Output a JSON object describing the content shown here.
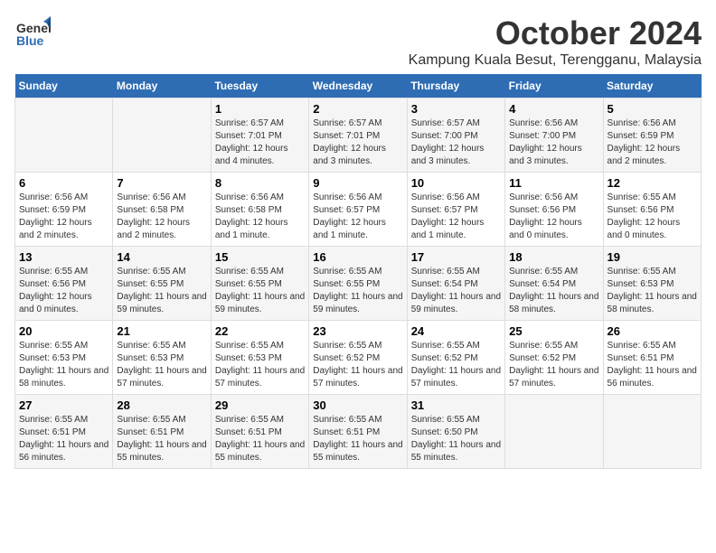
{
  "header": {
    "logo_line1": "General",
    "logo_line2": "Blue",
    "title": "October 2024",
    "subtitle": "Kampung Kuala Besut, Terengganu, Malaysia"
  },
  "weekdays": [
    "Sunday",
    "Monday",
    "Tuesday",
    "Wednesday",
    "Thursday",
    "Friday",
    "Saturday"
  ],
  "weeks": [
    [
      {
        "day": "",
        "sunrise": "",
        "sunset": "",
        "daylight": ""
      },
      {
        "day": "",
        "sunrise": "",
        "sunset": "",
        "daylight": ""
      },
      {
        "day": "1",
        "sunrise": "Sunrise: 6:57 AM",
        "sunset": "Sunset: 7:01 PM",
        "daylight": "Daylight: 12 hours and 4 minutes."
      },
      {
        "day": "2",
        "sunrise": "Sunrise: 6:57 AM",
        "sunset": "Sunset: 7:01 PM",
        "daylight": "Daylight: 12 hours and 3 minutes."
      },
      {
        "day": "3",
        "sunrise": "Sunrise: 6:57 AM",
        "sunset": "Sunset: 7:00 PM",
        "daylight": "Daylight: 12 hours and 3 minutes."
      },
      {
        "day": "4",
        "sunrise": "Sunrise: 6:56 AM",
        "sunset": "Sunset: 7:00 PM",
        "daylight": "Daylight: 12 hours and 3 minutes."
      },
      {
        "day": "5",
        "sunrise": "Sunrise: 6:56 AM",
        "sunset": "Sunset: 6:59 PM",
        "daylight": "Daylight: 12 hours and 2 minutes."
      }
    ],
    [
      {
        "day": "6",
        "sunrise": "Sunrise: 6:56 AM",
        "sunset": "Sunset: 6:59 PM",
        "daylight": "Daylight: 12 hours and 2 minutes."
      },
      {
        "day": "7",
        "sunrise": "Sunrise: 6:56 AM",
        "sunset": "Sunset: 6:58 PM",
        "daylight": "Daylight: 12 hours and 2 minutes."
      },
      {
        "day": "8",
        "sunrise": "Sunrise: 6:56 AM",
        "sunset": "Sunset: 6:58 PM",
        "daylight": "Daylight: 12 hours and 1 minute."
      },
      {
        "day": "9",
        "sunrise": "Sunrise: 6:56 AM",
        "sunset": "Sunset: 6:57 PM",
        "daylight": "Daylight: 12 hours and 1 minute."
      },
      {
        "day": "10",
        "sunrise": "Sunrise: 6:56 AM",
        "sunset": "Sunset: 6:57 PM",
        "daylight": "Daylight: 12 hours and 1 minute."
      },
      {
        "day": "11",
        "sunrise": "Sunrise: 6:56 AM",
        "sunset": "Sunset: 6:56 PM",
        "daylight": "Daylight: 12 hours and 0 minutes."
      },
      {
        "day": "12",
        "sunrise": "Sunrise: 6:55 AM",
        "sunset": "Sunset: 6:56 PM",
        "daylight": "Daylight: 12 hours and 0 minutes."
      }
    ],
    [
      {
        "day": "13",
        "sunrise": "Sunrise: 6:55 AM",
        "sunset": "Sunset: 6:56 PM",
        "daylight": "Daylight: 12 hours and 0 minutes."
      },
      {
        "day": "14",
        "sunrise": "Sunrise: 6:55 AM",
        "sunset": "Sunset: 6:55 PM",
        "daylight": "Daylight: 11 hours and 59 minutes."
      },
      {
        "day": "15",
        "sunrise": "Sunrise: 6:55 AM",
        "sunset": "Sunset: 6:55 PM",
        "daylight": "Daylight: 11 hours and 59 minutes."
      },
      {
        "day": "16",
        "sunrise": "Sunrise: 6:55 AM",
        "sunset": "Sunset: 6:55 PM",
        "daylight": "Daylight: 11 hours and 59 minutes."
      },
      {
        "day": "17",
        "sunrise": "Sunrise: 6:55 AM",
        "sunset": "Sunset: 6:54 PM",
        "daylight": "Daylight: 11 hours and 59 minutes."
      },
      {
        "day": "18",
        "sunrise": "Sunrise: 6:55 AM",
        "sunset": "Sunset: 6:54 PM",
        "daylight": "Daylight: 11 hours and 58 minutes."
      },
      {
        "day": "19",
        "sunrise": "Sunrise: 6:55 AM",
        "sunset": "Sunset: 6:53 PM",
        "daylight": "Daylight: 11 hours and 58 minutes."
      }
    ],
    [
      {
        "day": "20",
        "sunrise": "Sunrise: 6:55 AM",
        "sunset": "Sunset: 6:53 PM",
        "daylight": "Daylight: 11 hours and 58 minutes."
      },
      {
        "day": "21",
        "sunrise": "Sunrise: 6:55 AM",
        "sunset": "Sunset: 6:53 PM",
        "daylight": "Daylight: 11 hours and 57 minutes."
      },
      {
        "day": "22",
        "sunrise": "Sunrise: 6:55 AM",
        "sunset": "Sunset: 6:53 PM",
        "daylight": "Daylight: 11 hours and 57 minutes."
      },
      {
        "day": "23",
        "sunrise": "Sunrise: 6:55 AM",
        "sunset": "Sunset: 6:52 PM",
        "daylight": "Daylight: 11 hours and 57 minutes."
      },
      {
        "day": "24",
        "sunrise": "Sunrise: 6:55 AM",
        "sunset": "Sunset: 6:52 PM",
        "daylight": "Daylight: 11 hours and 57 minutes."
      },
      {
        "day": "25",
        "sunrise": "Sunrise: 6:55 AM",
        "sunset": "Sunset: 6:52 PM",
        "daylight": "Daylight: 11 hours and 57 minutes."
      },
      {
        "day": "26",
        "sunrise": "Sunrise: 6:55 AM",
        "sunset": "Sunset: 6:51 PM",
        "daylight": "Daylight: 11 hours and 56 minutes."
      }
    ],
    [
      {
        "day": "27",
        "sunrise": "Sunrise: 6:55 AM",
        "sunset": "Sunset: 6:51 PM",
        "daylight": "Daylight: 11 hours and 56 minutes."
      },
      {
        "day": "28",
        "sunrise": "Sunrise: 6:55 AM",
        "sunset": "Sunset: 6:51 PM",
        "daylight": "Daylight: 11 hours and 55 minutes."
      },
      {
        "day": "29",
        "sunrise": "Sunrise: 6:55 AM",
        "sunset": "Sunset: 6:51 PM",
        "daylight": "Daylight: 11 hours and 55 minutes."
      },
      {
        "day": "30",
        "sunrise": "Sunrise: 6:55 AM",
        "sunset": "Sunset: 6:51 PM",
        "daylight": "Daylight: 11 hours and 55 minutes."
      },
      {
        "day": "31",
        "sunrise": "Sunrise: 6:55 AM",
        "sunset": "Sunset: 6:50 PM",
        "daylight": "Daylight: 11 hours and 55 minutes."
      },
      {
        "day": "",
        "sunrise": "",
        "sunset": "",
        "daylight": ""
      },
      {
        "day": "",
        "sunrise": "",
        "sunset": "",
        "daylight": ""
      }
    ]
  ]
}
